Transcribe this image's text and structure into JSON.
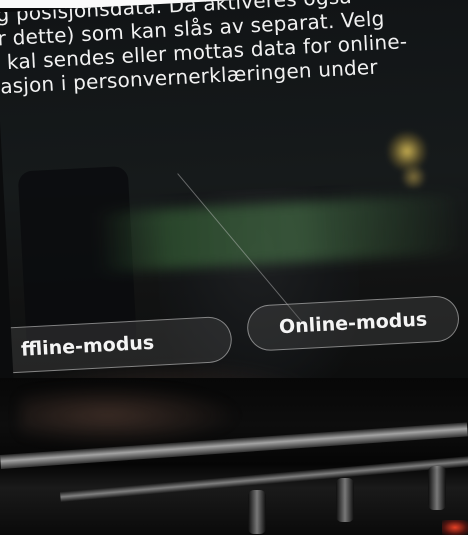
{
  "screen": {
    "text_lines": [
      "r dette) som kan slås av separat. Velg",
      "kal sendes eller mottas data for online-",
      "asjon i personvernerklæringen under"
    ],
    "text_top_partial": "g posisjonsdata. Da aktiveres også"
  },
  "buttons": {
    "offline_label": "ffline-modus",
    "online_label": "Online-modus"
  }
}
